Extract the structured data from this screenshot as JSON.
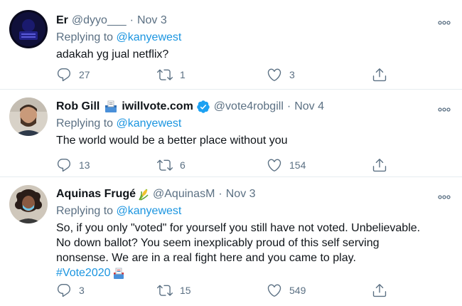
{
  "tweets": [
    {
      "name": "Er",
      "handle": "@dyyo___",
      "date": "Nov 3",
      "replying_prefix": "Replying to",
      "replying_to": "@kanyewest",
      "text": "adakah yg jual netflix?",
      "replies": "27",
      "retweets": "1",
      "likes": "3"
    },
    {
      "name": "Rob Gill",
      "name_suffix": "iwillvote.com",
      "handle": "@vote4robgill",
      "date": "Nov 4",
      "replying_prefix": "Replying to",
      "replying_to": "@kanyewest",
      "text": "The world would be a better place without you",
      "replies": "13",
      "retweets": "6",
      "likes": "154"
    },
    {
      "name": "Aquinas Frugé",
      "handle": "@AquinasM",
      "date": "Nov 3",
      "replying_prefix": "Replying to",
      "replying_to": "@kanyewest",
      "text_lines": [
        "So, if you only \"voted\" for yourself you still have not voted. Unbelievable.",
        "No down ballot? You seem inexplicably proud of this self serving",
        "nonsense. We are in a real fight here and you came to play."
      ],
      "hashtag": "#Vote2020",
      "replies": "3",
      "retweets": "15",
      "likes": "549"
    }
  ],
  "separator": "·",
  "icons": {
    "reply": "reply-icon",
    "retweet": "retweet-icon",
    "like": "heart-icon",
    "share": "share-icon",
    "more": "more-icon",
    "verified": "verified-badge-icon",
    "ballot": "ballot-box-icon",
    "corn": "corn-emoji-icon",
    "ballot_emoji": "ballot-emoji-icon"
  },
  "colors": {
    "link": "#1b95e0",
    "muted": "#5b7083",
    "text": "#0f1419",
    "divider": "#e6ecf0",
    "verified": "#1da1f2"
  }
}
